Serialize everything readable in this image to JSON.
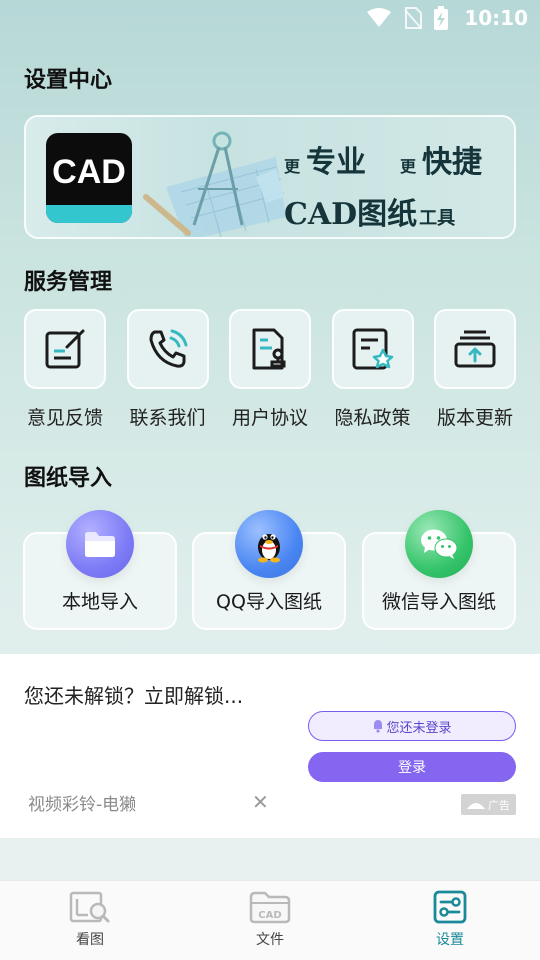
{
  "status_bar": {
    "time": "10:10"
  },
  "page": {
    "title": "设置中心"
  },
  "banner": {
    "logo_text": "CAD",
    "slogan": {
      "prefix1": "更",
      "word1": "专业",
      "prefix2": "更",
      "word2": "快捷",
      "line2_main": "CAD图纸",
      "line2_tail": "工具"
    }
  },
  "services": {
    "title": "服务管理",
    "items": [
      {
        "label": "意见反馈",
        "icon": "feedback-edit-icon"
      },
      {
        "label": "联系我们",
        "icon": "phone-call-icon"
      },
      {
        "label": "用户协议",
        "icon": "user-agreement-icon"
      },
      {
        "label": "隐私政策",
        "icon": "privacy-policy-icon"
      },
      {
        "label": "版本更新",
        "icon": "version-update-icon"
      }
    ]
  },
  "import": {
    "title": "图纸导入",
    "items": [
      {
        "label": "本地导入",
        "icon": "folder-icon",
        "color": "#7d7bf5"
      },
      {
        "label": "QQ导入图纸",
        "icon": "qq-penguin-icon",
        "color": "#4a86f2"
      },
      {
        "label": "微信导入图纸",
        "icon": "wechat-icon",
        "color": "#35c46a"
      }
    ]
  },
  "ad": {
    "title": "您还未解锁？立即解锁...",
    "not_logged_label": "您还未登录",
    "login_label": "登录",
    "source": "视频彩铃-电獭",
    "close_icon": "close-icon",
    "tag_label": "广告"
  },
  "nav": {
    "items": [
      {
        "label": "看图",
        "icon": "view-drawing-icon",
        "active": false
      },
      {
        "label": "文件",
        "icon": "cad-folder-icon",
        "active": false
      },
      {
        "label": "设置",
        "icon": "settings-sliders-icon",
        "active": true
      }
    ]
  },
  "colors": {
    "accent": "#1a8a98",
    "ad_purple": "#8566f0"
  }
}
